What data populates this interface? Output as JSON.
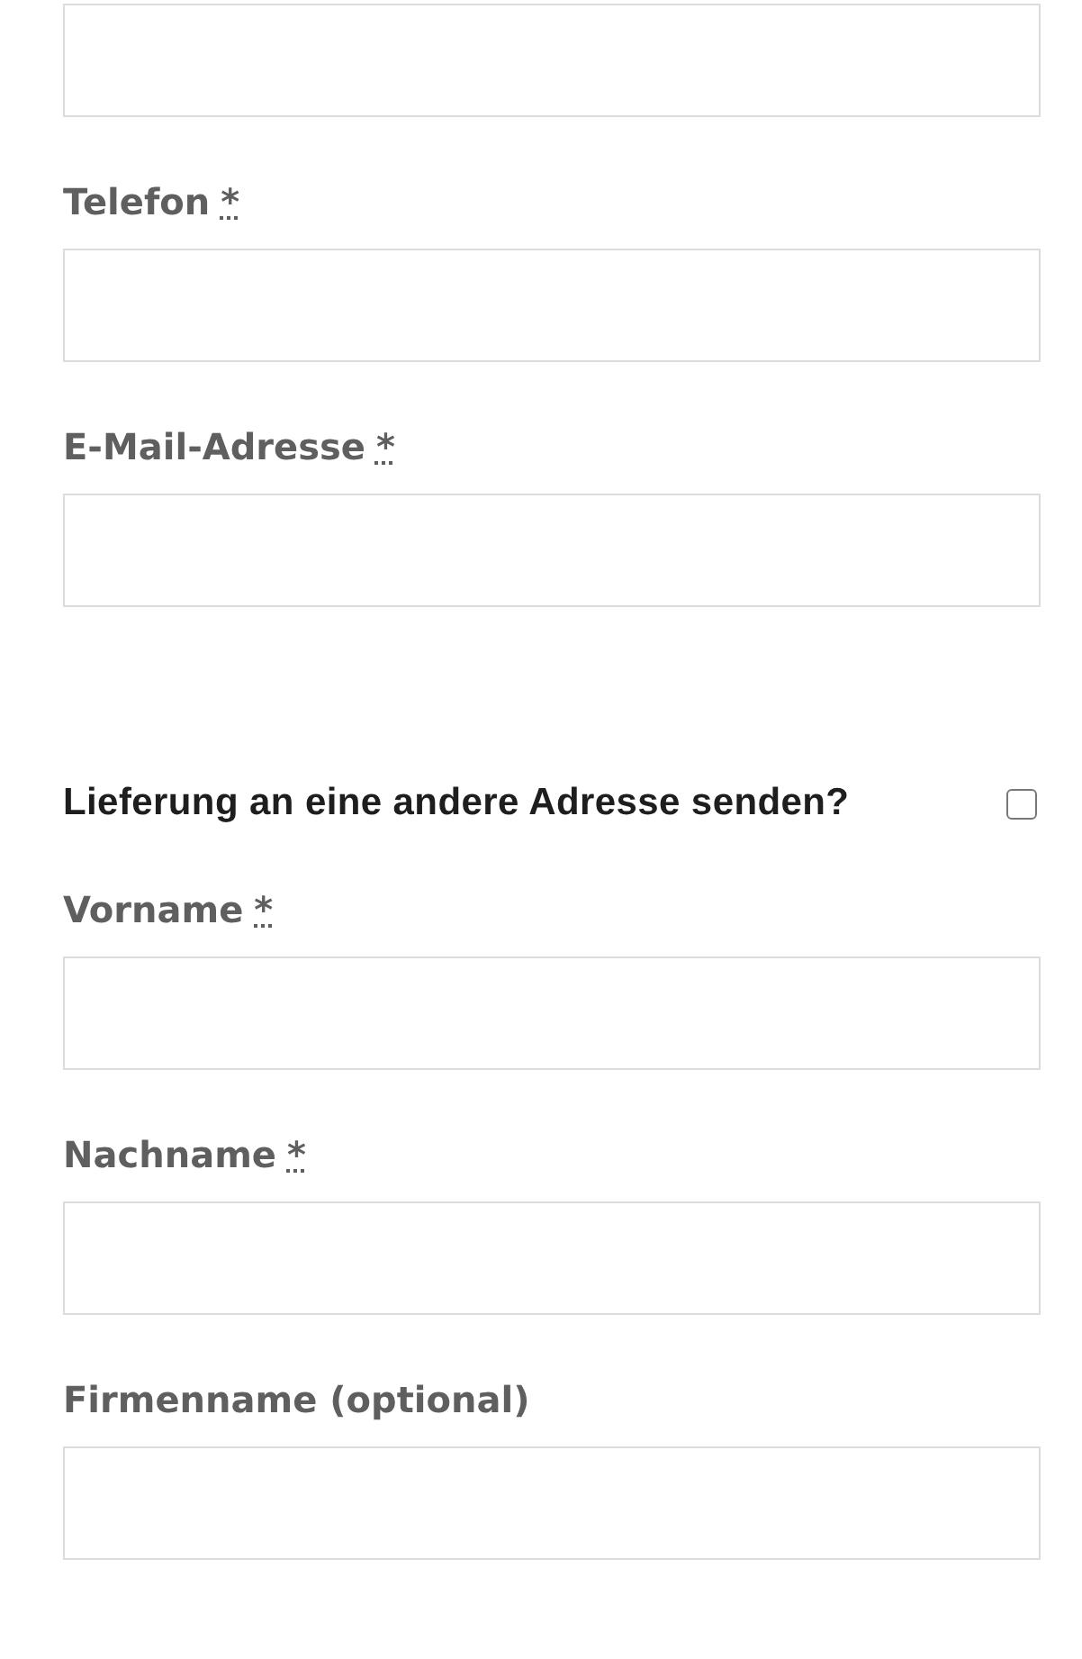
{
  "billing_fields": [
    {
      "kind": "cut"
    },
    {
      "kind": "full",
      "label": "Telefon",
      "required_mark": "*"
    },
    {
      "kind": "full",
      "label": "E-Mail-Adresse",
      "required_mark": "*"
    }
  ],
  "ship_to_different": {
    "title": "Lieferung an eine andere Adresse senden?",
    "checked": false
  },
  "shipping_fields": [
    {
      "kind": "full",
      "label": "Vorname",
      "required_mark": "*"
    },
    {
      "kind": "full",
      "label": "Nachname",
      "required_mark": "*"
    },
    {
      "kind": "full",
      "label": "Firmenname (optional)"
    }
  ]
}
